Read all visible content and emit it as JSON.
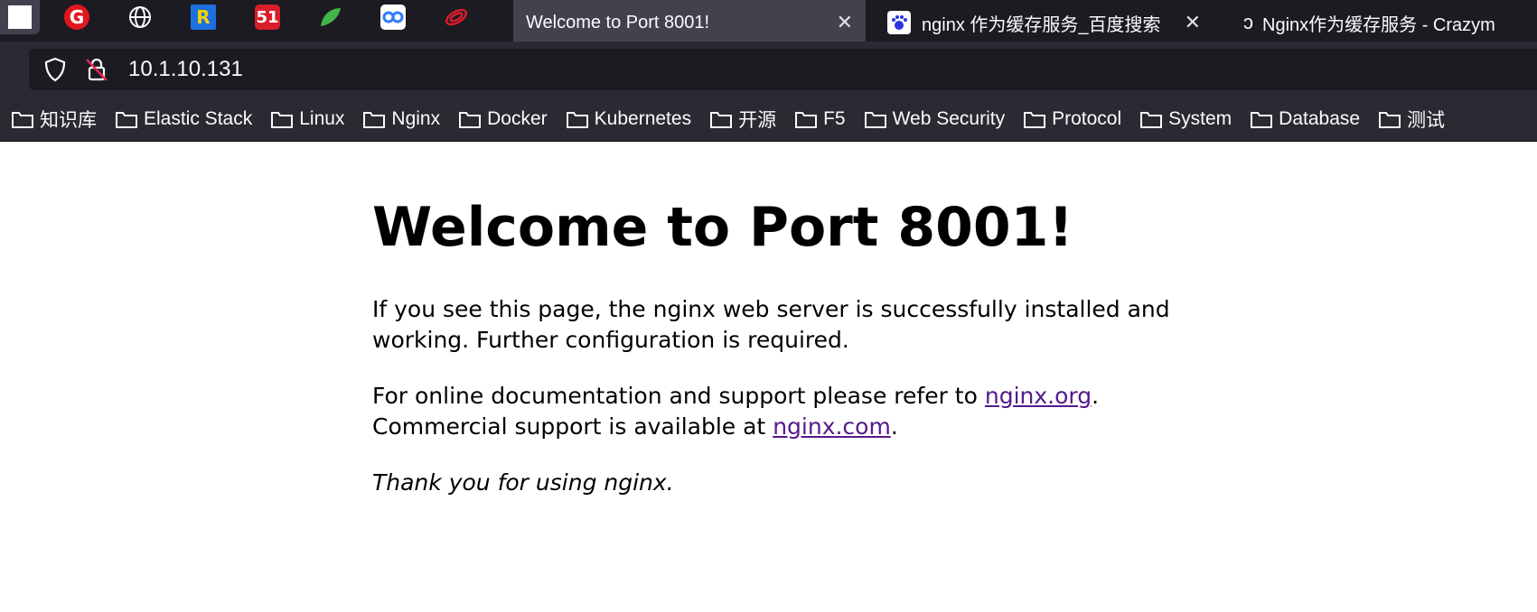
{
  "tabs": {
    "active_title": "Welcome to Port 8001!",
    "tab2_title": "nginx 作为缓存服务_百度搜索",
    "tab3_title": "Nginx作为缓存服务 - Crazym"
  },
  "pinned_icons": [
    "G",
    "globe-icon",
    "R",
    "51",
    "leaf-icon",
    "baidu-cloud-icon",
    "swirl-icon"
  ],
  "address_bar": {
    "url": "10.1.10.131"
  },
  "bookmarks": [
    "知识库",
    "Elastic Stack",
    "Linux",
    "Nginx",
    "Docker",
    "Kubernetes",
    "开源",
    "F5",
    "Web Security",
    "Protocol",
    "System",
    "Database",
    "测试"
  ],
  "page": {
    "heading": "Welcome to Port 8001!",
    "para1": "If you see this page, the nginx web server is successfully installed and working. Further configuration is required.",
    "para2_prefix": "For online documentation and support please refer to",
    "link1": "nginx.org",
    "para2_mid": "Commercial support is available at",
    "link2": "nginx.com",
    "thanks": "Thank you for using nginx."
  },
  "colors": {
    "chrome_bg": "#1c1b22",
    "toolbar_bg": "#2b2a33",
    "active_tab": "#42414d",
    "link": "#551a8b"
  }
}
